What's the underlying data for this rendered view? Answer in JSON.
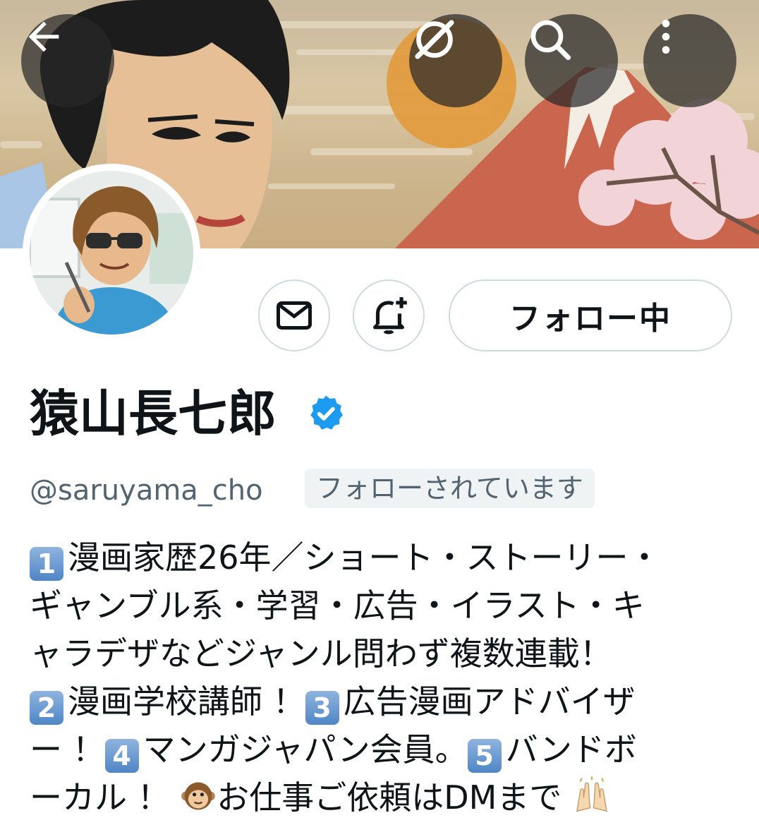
{
  "header": {
    "back_icon": "arrow-left-icon",
    "grok_icon": "grok-icon",
    "search_icon": "search-icon",
    "more_icon": "more-vertical-icon"
  },
  "profile": {
    "display_name": "猿山長七郎",
    "verified_icon": "verified-badge-icon",
    "handle": "@saruyama_cho",
    "follows_you": "フォローされています",
    "following_label": "フォロー中",
    "dm_icon": "mail-icon",
    "notify_icon": "bell-plus-icon"
  },
  "bio": {
    "line1": "漫画家歴26年／ショート・ストーリー・",
    "line2": "ギャンブル系・学習・広告・イラスト・キ",
    "line3": "ャラデザなどジャンル問わず複数連載！",
    "k2": "2",
    "line4a": "漫画学校講師 ！",
    "k3": "3",
    "line4b": "広告漫画アドバイザ",
    "line5a": "ー ！",
    "k4": "4",
    "line5b": "マンガジャパン会員。",
    "k5": "5",
    "line5c": "バンドボ",
    "line6": "ーカル ！",
    "line6b": "お仕事ご依頼はDMまで",
    "k1": "1"
  },
  "colors": {
    "accent": "#1d9bf0",
    "text": "#0f1419",
    "secondary": "#536471",
    "border": "#cfd9de"
  }
}
